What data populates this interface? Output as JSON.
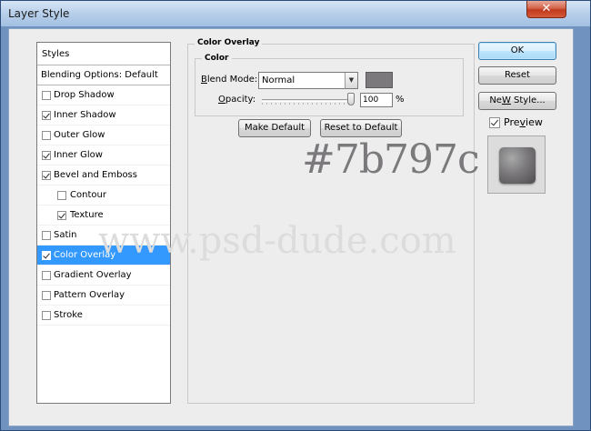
{
  "window": {
    "title": "Layer Style",
    "close_glyph": "✕"
  },
  "styles_panel": {
    "header": "Styles",
    "blending_label": "Blending Options: Default",
    "items": [
      {
        "label": "Drop Shadow",
        "checked": false,
        "sub": false,
        "selected": false
      },
      {
        "label": "Inner Shadow",
        "checked": true,
        "sub": false,
        "selected": false
      },
      {
        "label": "Outer Glow",
        "checked": false,
        "sub": false,
        "selected": false
      },
      {
        "label": "Inner Glow",
        "checked": true,
        "sub": false,
        "selected": false
      },
      {
        "label": "Bevel and Emboss",
        "checked": true,
        "sub": false,
        "selected": false
      },
      {
        "label": "Contour",
        "checked": false,
        "sub": true,
        "selected": false
      },
      {
        "label": "Texture",
        "checked": true,
        "sub": true,
        "selected": false
      },
      {
        "label": "Satin",
        "checked": false,
        "sub": false,
        "selected": false
      },
      {
        "label": "Color Overlay",
        "checked": true,
        "sub": false,
        "selected": true
      },
      {
        "label": "Gradient Overlay",
        "checked": false,
        "sub": false,
        "selected": false
      },
      {
        "label": "Pattern Overlay",
        "checked": false,
        "sub": false,
        "selected": false
      },
      {
        "label": "Stroke",
        "checked": false,
        "sub": false,
        "selected": false
      }
    ]
  },
  "color_overlay": {
    "group_title": "Color Overlay",
    "subgroup_title": "Color",
    "blend_mode_label_accel": "B",
    "blend_mode_label_rest": "lend Mode:",
    "blend_mode_value": "Normal",
    "opacity_label_accel": "O",
    "opacity_label_rest": "pacity:",
    "opacity_value": "100",
    "opacity_unit": "%",
    "opacity_fraction": 1.0,
    "swatch_color": "#7b797c",
    "make_default_label": "Make Default",
    "reset_default_label": "Reset to Default"
  },
  "buttons": {
    "ok": "OK",
    "reset": "Reset",
    "new_style_accel": "W",
    "new_style_prefix": "Ne",
    "new_style_suffix": " Style..."
  },
  "preview": {
    "label_accel": "v",
    "label_prefix": "Pre",
    "label_suffix": "iew",
    "checked": true
  },
  "overlay_text": {
    "hex": "#7b797c",
    "site": "www.psd-dude.com"
  }
}
